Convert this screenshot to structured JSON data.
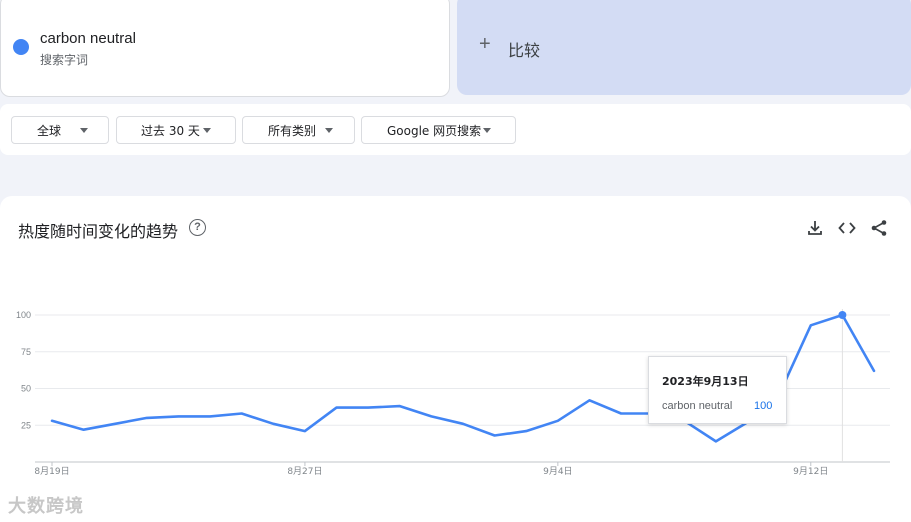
{
  "search_term": {
    "name": "carbon neutral",
    "sublabel": "搜索字词",
    "color": "#4285f4"
  },
  "compare": {
    "label": "比较"
  },
  "filters": [
    {
      "label": "全球"
    },
    {
      "label": "过去 30 天"
    },
    {
      "label": "所有类别"
    },
    {
      "label": "Google 网页搜索"
    }
  ],
  "section": {
    "title": "热度随时间变化的趋势"
  },
  "tooltip": {
    "date": "2023年9月13日",
    "term": "carbon neutral",
    "value": "100"
  },
  "watermark": "大数跨境",
  "chart_data": {
    "type": "line",
    "x": [
      "8月19日",
      "8月20日",
      "8月21日",
      "8月22日",
      "8月23日",
      "8月24日",
      "8月25日",
      "8月26日",
      "8月27日",
      "8月28日",
      "8月29日",
      "8月30日",
      "8月31日",
      "9月1日",
      "9月2日",
      "9月3日",
      "9月4日",
      "9月5日",
      "9月6日",
      "9月7日",
      "9月8日",
      "9月9日",
      "9月10日",
      "9月11日",
      "9月12日",
      "9月13日",
      "9月14日"
    ],
    "xticks": [
      "8月19日",
      "8月27日",
      "9月4日",
      "9月12日"
    ],
    "yticks": [
      100,
      75,
      50,
      25
    ],
    "ylim": [
      0,
      100
    ],
    "series": [
      {
        "name": "carbon neutral",
        "color": "#4285f4",
        "values": [
          28,
          22,
          26,
          30,
          31,
          31,
          33,
          26,
          21,
          37,
          37,
          38,
          31,
          26,
          18,
          21,
          28,
          42,
          33,
          33,
          28,
          14,
          27,
          46,
          93,
          100,
          62
        ]
      }
    ],
    "highlight": "9月13日",
    "grid": true
  }
}
